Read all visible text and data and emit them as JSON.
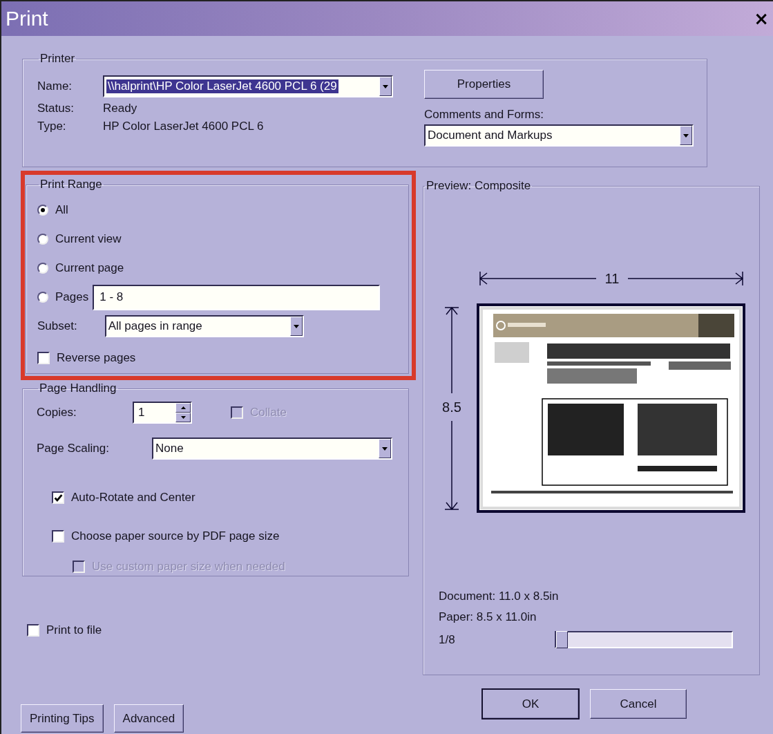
{
  "window": {
    "title": "Print",
    "close": "×"
  },
  "printer": {
    "legend": "Printer",
    "name_label": "Name:",
    "name_value": "\\\\halprint\\HP Color LaserJet 4600 PCL 6 (29",
    "name_highlighted": true,
    "status_label": "Status:",
    "status": "Ready",
    "type_label": "Type:",
    "type": "HP Color LaserJet 4600 PCL 6",
    "properties_button": "Properties",
    "comments_label": "Comments and Forms:",
    "comments_value": "Document and Markups"
  },
  "print_range": {
    "legend": "Print Range",
    "options": [
      {
        "label": "All",
        "selected": true
      },
      {
        "label": "Current view",
        "selected": false
      },
      {
        "label": "Current page",
        "selected": false
      },
      {
        "label": "Pages",
        "selected": false
      }
    ],
    "pages_value": "1 - 8",
    "subset_label": "Subset:",
    "subset_value": "All pages in range",
    "reverse": {
      "label": "Reverse pages",
      "checked": false
    }
  },
  "page_handling": {
    "legend": "Page Handling",
    "copies_label": "Copies:",
    "copies_value": "1",
    "collate": {
      "label": "Collate",
      "checked": false,
      "disabled": true
    },
    "scaling_label": "Page Scaling:",
    "scaling_value": "None",
    "options": [
      {
        "label": "Auto-Rotate and Center",
        "checked": true,
        "disabled": false
      },
      {
        "label": "Choose paper source by PDF page size",
        "checked": false,
        "disabled": false,
        "children": [
          {
            "label": "Use custom paper size when needed",
            "checked": false,
            "disabled": true
          }
        ]
      }
    ]
  },
  "print_to_file": {
    "label": "Print to file",
    "checked": false
  },
  "preview": {
    "legend": "Preview: Composite",
    "width_label": "11",
    "height_label": "8.5",
    "document": "Document: 11.0 x 8.5in",
    "paper": "Paper: 8.5 x 11.0in",
    "page_indicator": "1/8",
    "page_slider": {
      "level": 0
    }
  },
  "footer_left": [
    "Printing Tips",
    "Advanced"
  ],
  "dialog_buttons": [
    {
      "label": "OK",
      "default": true
    },
    {
      "label": "Cancel",
      "default": false
    }
  ]
}
